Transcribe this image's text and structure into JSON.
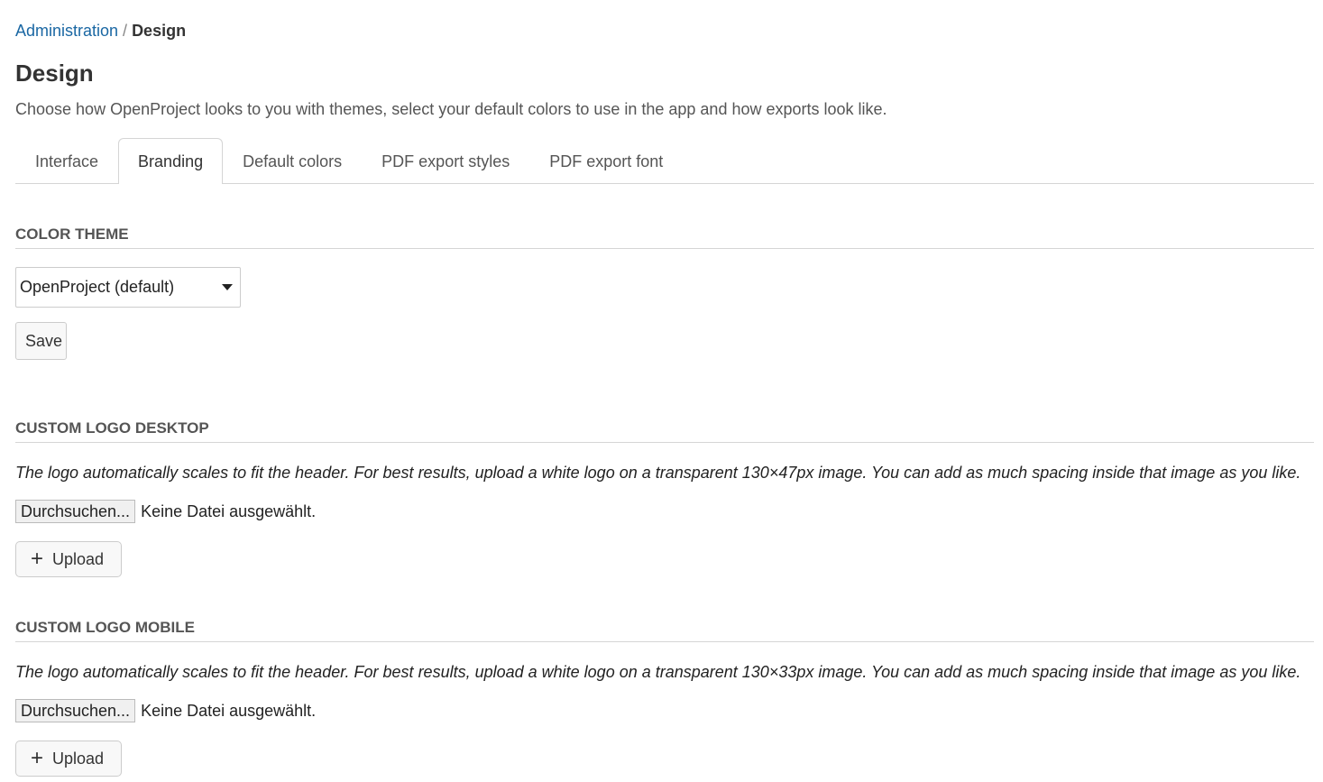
{
  "breadcrumb": {
    "parent": "Administration",
    "separator": "/",
    "current": "Design"
  },
  "page": {
    "title": "Design",
    "description": "Choose how OpenProject looks to you with themes, select your default colors to use in the app and how exports look like."
  },
  "tabs": [
    {
      "label": "Interface",
      "active": false
    },
    {
      "label": "Branding",
      "active": true
    },
    {
      "label": "Default colors",
      "active": false
    },
    {
      "label": "PDF export styles",
      "active": false
    },
    {
      "label": "PDF export font",
      "active": false
    }
  ],
  "color_theme": {
    "header": "COLOR THEME",
    "selected": "OpenProject (default)",
    "save_label": "Save"
  },
  "logo_desktop": {
    "header": "CUSTOM LOGO DESKTOP",
    "help": "The logo automatically scales to fit the header. For best results, upload a white logo on a transparent 130×47px image. You can add as much spacing inside that image as you like.",
    "browse_label": "Durchsuchen...",
    "file_status": "Keine Datei ausgewählt.",
    "upload_label": "Upload"
  },
  "logo_mobile": {
    "header": "CUSTOM LOGO MOBILE",
    "help": "The logo automatically scales to fit the header. For best results, upload a white logo on a transparent 130×33px image. You can add as much spacing inside that image as you like.",
    "browse_label": "Durchsuchen...",
    "file_status": "Keine Datei ausgewählt.",
    "upload_label": "Upload"
  },
  "colors": {
    "link": "#1a67a3",
    "border": "#d5d5d5"
  }
}
